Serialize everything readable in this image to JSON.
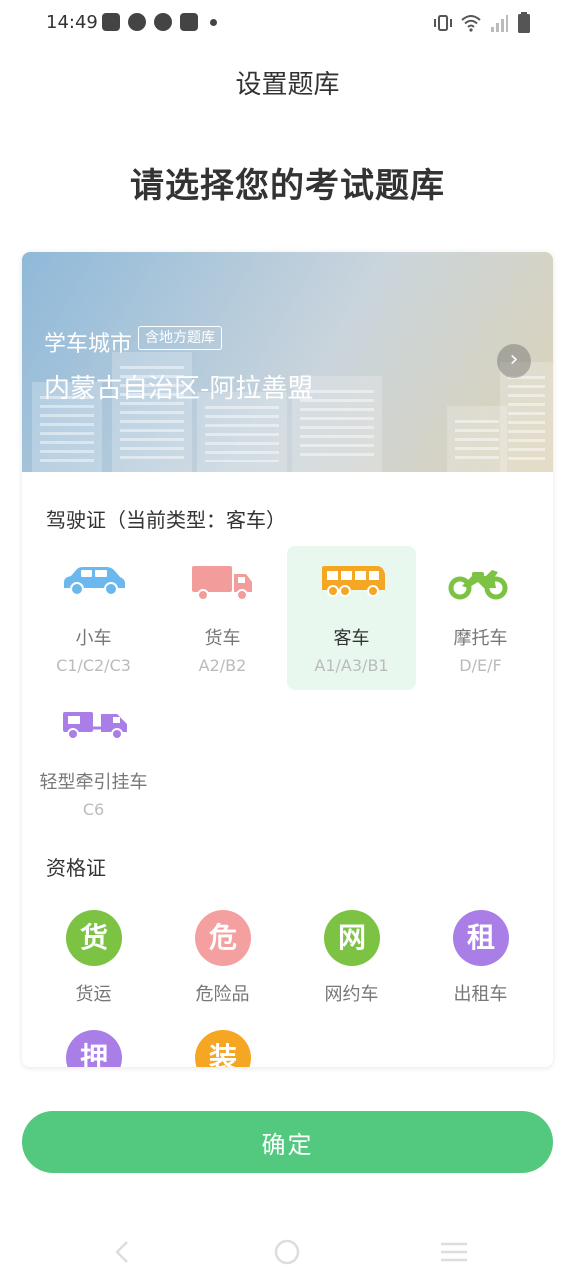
{
  "status_bar": {
    "time": "14:49",
    "left_icons": [
      "shopping-bag-icon",
      "compass-icon",
      "compass-icon",
      "shopping-bag-icon",
      "dot-icon"
    ],
    "right_icons": [
      "vibrate-icon",
      "wifi-icon",
      "signal-icon",
      "battery-icon"
    ]
  },
  "header": {
    "title": "设置题库"
  },
  "main": {
    "heading": "请选择您的考试题库",
    "banner": {
      "city_label": "学车城市",
      "badge": "含地方题库",
      "region": "内蒙古自治区-阿拉善盟"
    },
    "license": {
      "title": "驾驶证（当前类型：客车）",
      "items": [
        {
          "label": "小车",
          "code": "C1/C2/C3",
          "icon": "car-icon",
          "color": "#6ab8ee",
          "selected": false
        },
        {
          "label": "货车",
          "code": "A2/B2",
          "icon": "truck-icon",
          "color": "#f29c9c",
          "selected": false
        },
        {
          "label": "客车",
          "code": "A1/A3/B1",
          "icon": "bus-icon",
          "color": "#f5a623",
          "selected": true
        },
        {
          "label": "摩托车",
          "code": "D/E/F",
          "icon": "motorcycle-icon",
          "color": "#7cc243",
          "selected": false
        },
        {
          "label": "轻型牵引挂车",
          "code": "C6",
          "icon": "trailer-icon",
          "color": "#a97ee6",
          "selected": false
        }
      ]
    },
    "certificates": {
      "title": "资格证",
      "items": [
        {
          "char": "货",
          "label": "货运",
          "color": "#7cc243"
        },
        {
          "char": "危",
          "label": "危险品",
          "color": "#f5a0a0"
        },
        {
          "char": "网",
          "label": "网约车",
          "color": "#7cc243"
        },
        {
          "char": "租",
          "label": "出租车",
          "color": "#a97ee6"
        },
        {
          "char": "押",
          "label": "",
          "color": "#a97ee6"
        },
        {
          "char": "装",
          "label": "",
          "color": "#f5a623"
        }
      ]
    }
  },
  "footer": {
    "confirm_label": "确定"
  },
  "nav": {
    "icons": [
      "back-icon",
      "home-icon",
      "menu-icon"
    ]
  },
  "colors": {
    "accent": "#52c97f",
    "selected_bg": "#e8f8ee"
  }
}
